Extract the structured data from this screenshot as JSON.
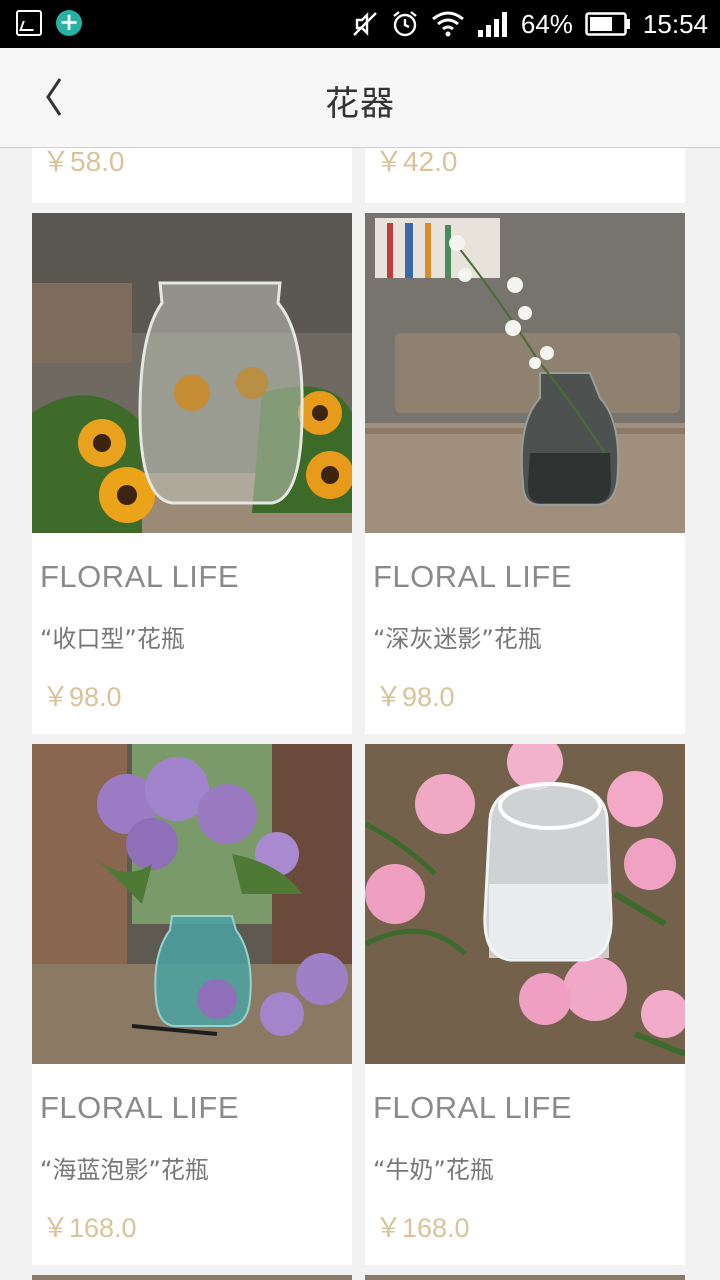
{
  "status_bar": {
    "battery": "64%",
    "time": "15:54",
    "icons": [
      "gallery-icon",
      "add-badge-icon",
      "mute-icon",
      "alarm-icon",
      "wifi-icon",
      "signal-icon",
      "battery-icon"
    ]
  },
  "header": {
    "title": "花器",
    "back_icon": "chevron-left-icon"
  },
  "partial_row": [
    {
      "price": "￥58.0"
    },
    {
      "price": "￥42.0"
    }
  ],
  "products": [
    {
      "brand": "FLORAL LIFE",
      "name": "“收口型”花瓶",
      "price": "￥98.0",
      "image": "clear vase with sunflowers"
    },
    {
      "brand": "FLORAL LIFE",
      "name": "“深灰迷影”花瓶",
      "price": "￥98.0",
      "image": "dark grey vase with white flowers"
    },
    {
      "brand": "FLORAL LIFE",
      "name": "“海蓝泡影”花瓶",
      "price": "￥168.0",
      "image": "blue vase with lilac"
    },
    {
      "brand": "FLORAL LIFE",
      "name": "“牛奶”花瓶",
      "price": "￥168.0",
      "image": "milk bottle vase with peonies"
    }
  ],
  "colors": {
    "price": "#d8c39a",
    "brand": "#8a8a8a",
    "background": "#f2f2f2",
    "accent_badge": "#26b1a0"
  }
}
